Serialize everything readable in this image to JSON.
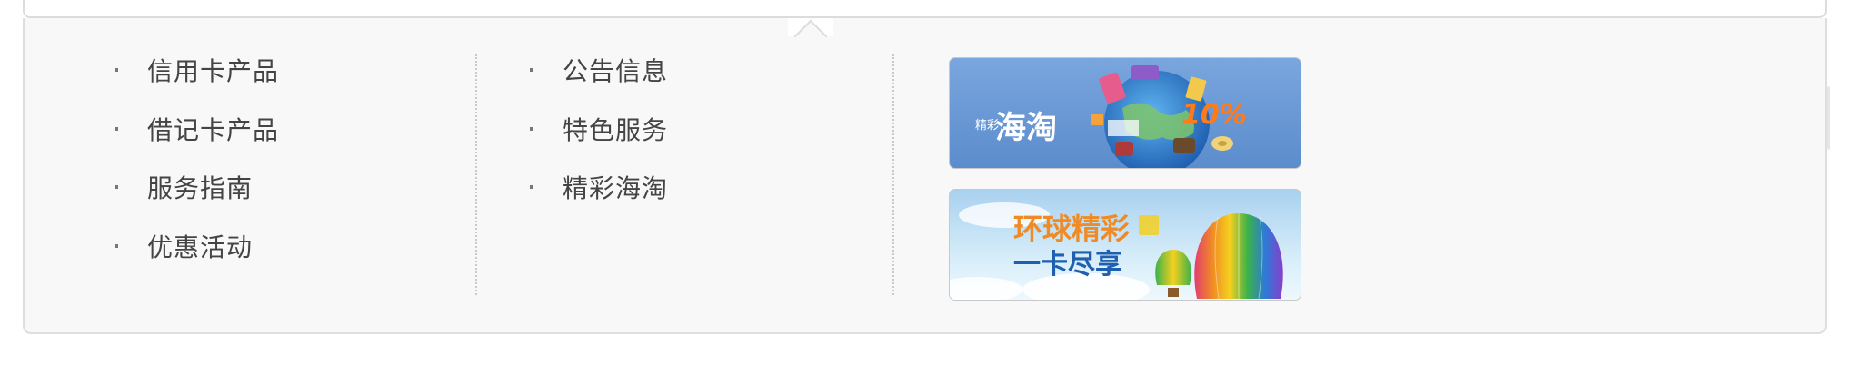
{
  "menu": {
    "column1": [
      {
        "label": "信用卡产品"
      },
      {
        "label": "借记卡产品"
      },
      {
        "label": "服务指南"
      },
      {
        "label": "优惠活动"
      }
    ],
    "column2": [
      {
        "label": "公告信息"
      },
      {
        "label": "特色服务"
      },
      {
        "label": "精彩海淘"
      }
    ]
  },
  "banners": [
    {
      "small_text": "精彩",
      "main_text": "海淘",
      "badge_text": "10%",
      "bg_color": "#6d9bd7"
    },
    {
      "line1": "环球精彩",
      "line2": "一卡尽享",
      "bg_color": "#c6e4f6"
    }
  ],
  "colors": {
    "panel_bg": "#f8f8f8",
    "text": "#444444",
    "border": "#dedede"
  }
}
